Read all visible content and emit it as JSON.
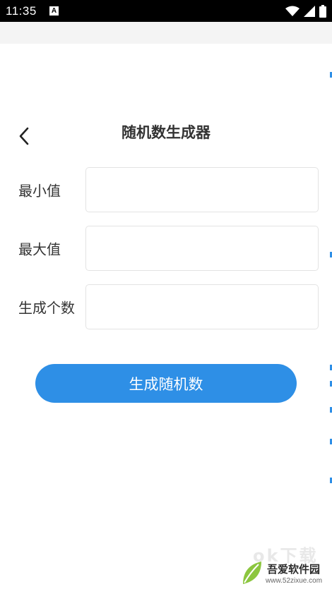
{
  "status_bar": {
    "time": "11:35",
    "notification_letter": "A"
  },
  "header": {
    "title": "随机数生成器"
  },
  "form": {
    "min": {
      "label": "最小值",
      "value": ""
    },
    "max": {
      "label": "最大值",
      "value": ""
    },
    "count": {
      "label": "生成个数",
      "value": ""
    }
  },
  "actions": {
    "generate_label": "生成随机数"
  },
  "watermark": {
    "top_text": "ok下载",
    "brand": "吾爱软件园",
    "url": "www.52zixue.com"
  },
  "colors": {
    "accent": "#2e8fe6",
    "status_bar": "#000000",
    "band": "#f4f4f4"
  }
}
